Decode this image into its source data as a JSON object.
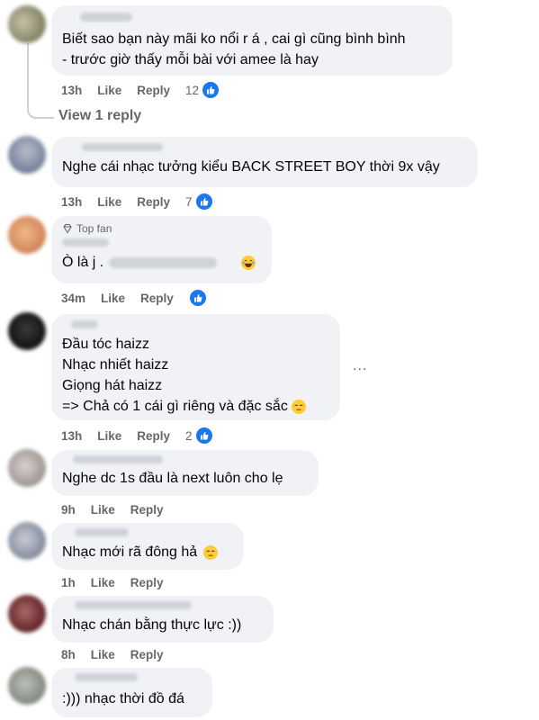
{
  "comments": [
    {
      "lines": [
        "Biết sao bạn này mãi ko nổi r á , cai gì cũng bình bình",
        "- trước giờ thấy mỗi bài với amee là hay"
      ],
      "time": "13h",
      "like": "Like",
      "reply": "Reply",
      "likes": "12"
    },
    {
      "lines": [
        "Nghe cái nhạc tưởng kiểu BACK STREET BOY thời 9x vậy"
      ],
      "time": "13h",
      "like": "Like",
      "reply": "Reply",
      "likes": "7"
    },
    {
      "badge": "Top fan",
      "lines": [
        "Ò là j ."
      ],
      "time": "34m",
      "like": "Like",
      "reply": "Reply",
      "likes": ""
    },
    {
      "lines": [
        "Đầu tóc haizz",
        "Nhạc nhiết haizz",
        "Giọng hát haizz",
        "=> Chả có 1 cái gì riêng và đặc sắc"
      ],
      "time": "13h",
      "like": "Like",
      "reply": "Reply",
      "likes": "2"
    },
    {
      "lines": [
        "Nghe dc 1s đầu là next luôn cho lẹ"
      ],
      "time": "9h",
      "like": "Like",
      "reply": "Reply"
    },
    {
      "lines": [
        "Nhạc mới rã đông hả"
      ],
      "time": "1h",
      "like": "Like",
      "reply": "Reply"
    },
    {
      "lines": [
        "Nhạc chán bằng thực lực :))"
      ],
      "time": "8h",
      "like": "Like",
      "reply": "Reply"
    },
    {
      "lines": [
        ":))) nhạc thời đồ đá"
      ]
    }
  ],
  "view_replies": "View 1 reply",
  "more_label": "...",
  "icons": {
    "like": "like-thumb-icon",
    "emoji_laugh": "laughing-emoji-icon",
    "emoji_unamused": "unamused-emoji-icon",
    "top_fan": "diamond-icon"
  },
  "colors": {
    "accent": "#1877f2",
    "bubble": "#f0f2f5",
    "meta": "#65676b"
  }
}
